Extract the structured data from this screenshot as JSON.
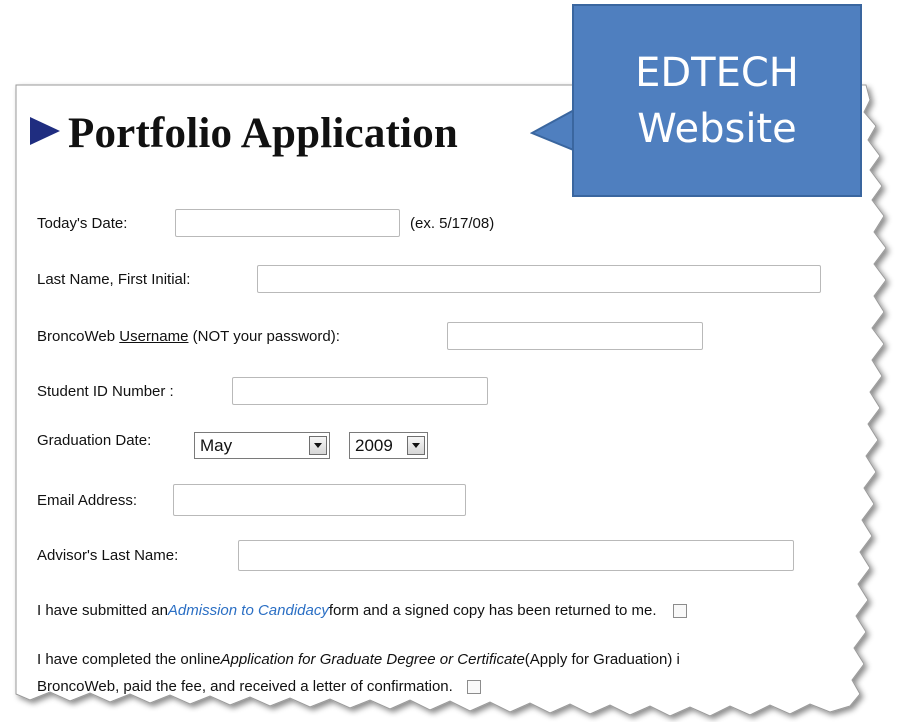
{
  "page": {
    "title": "Portfolio Application"
  },
  "form": {
    "todays_date": {
      "label": "Today's Date:",
      "value": "",
      "hint": "(ex. 5/17/08)"
    },
    "last_name": {
      "label": "Last Name, First Initial:",
      "value": ""
    },
    "username": {
      "label_prefix": "BroncoWeb ",
      "label_underlined": "Username",
      "label_suffix": " (NOT your password):",
      "value": ""
    },
    "student_id": {
      "label": "Student ID Number :",
      "value": ""
    },
    "graduation": {
      "label": "Graduation Date:",
      "month": "May",
      "year": "2009"
    },
    "email": {
      "label": "Email Address:",
      "value": ""
    },
    "advisor": {
      "label": "Advisor's Last  Name:",
      "value": ""
    },
    "admission": {
      "text_before": "I have submitted an ",
      "link": "Admission to Candidacy",
      "text_after": " form and a signed copy has been returned to me.",
      "checked": false
    },
    "graduation_application": {
      "text_before": "I have completed the online ",
      "italic": "Application for Graduate Degree or Certificate",
      "text_after": "  (Apply for Graduation) i",
      "line2": "BroncoWeb, paid the fee, and received a letter of confirmation.",
      "checked": false
    }
  },
  "callout": {
    "line1": "EDTECH",
    "line2": "Website",
    "fill_color": "#4f7fbf",
    "border_color": "#3a669f"
  },
  "colors": {
    "title_arrow": "#1f2d80",
    "link": "#2b6fc4"
  }
}
